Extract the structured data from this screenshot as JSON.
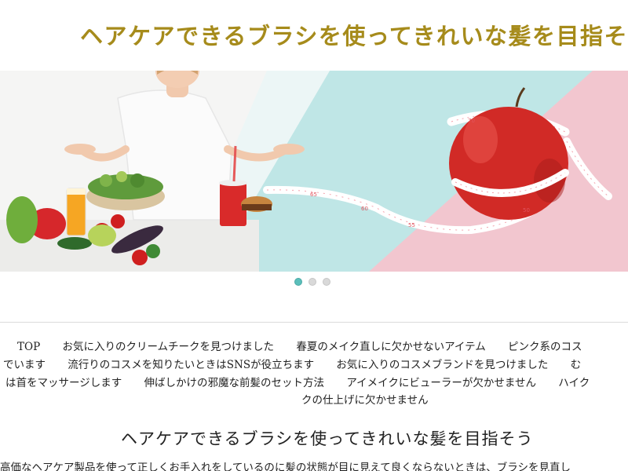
{
  "header": {
    "site_title": "ヘアケアできるブラシを使ってきれいな髪を目指そ"
  },
  "hero": {
    "slides": 3,
    "active_slide": 1,
    "tape_marks": [
      "70",
      "50",
      "55",
      "60",
      "65"
    ]
  },
  "nav": {
    "line1": [
      "TOP",
      "お気に入りのクリームチークを見つけました",
      "春夏のメイク直しに欠かせないアイテム",
      "ピンク系のコス"
    ],
    "line2": [
      "でいます",
      "流行りのコスメを知りたいときはSNSが役立ちます",
      "お気に入りのコスメブランドを見つけました",
      "む"
    ],
    "line3": [
      "は首をマッサージします",
      "伸ばしかけの邪魔な前髪のセット方法",
      "アイメイクにビューラーが欠かせません",
      "ハイク"
    ],
    "line4": [
      "クの仕上げに欠かせません"
    ]
  },
  "main": {
    "heading": "ヘアケアできるブラシを使ってきれいな髪を目指そう",
    "intro": "高価なヘアケア製品を使って正しくお手入れをしているのに髪の状態が目に見えて良くならないときは、ブラシを見直し"
  },
  "colors": {
    "title": "#a68b1b",
    "dot_active": "#5bbfbb",
    "dot_inactive": "#d9d9d9"
  }
}
